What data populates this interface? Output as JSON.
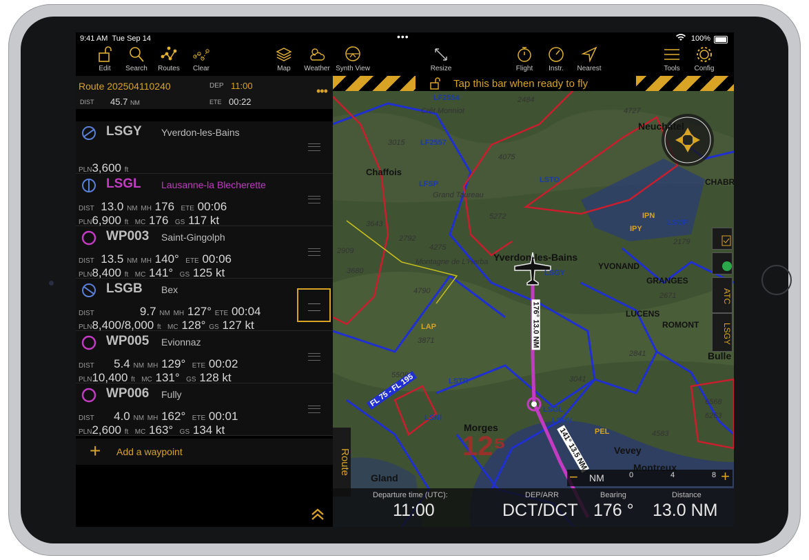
{
  "status_bar": {
    "time": "9:41 AM",
    "date": "Tue Sep 14",
    "dots": "•••",
    "battery": "100%"
  },
  "toolbar": {
    "edit": "Edit",
    "search": "Search",
    "routes": "Routes",
    "clear": "Clear",
    "map": "Map",
    "weather": "Weather",
    "synth_view": "Synth View",
    "resize": "Resize",
    "flight": "Flight",
    "instr": "Instr.",
    "nearest": "Nearest",
    "tools": "Tools",
    "config": "Config"
  },
  "route": {
    "title": "Route 202504110240",
    "dep_label": "DEP",
    "dep_value": "11:00",
    "dist_label": "DIST",
    "dist_value": "45.7",
    "dist_unit": "NM",
    "ete_label": "ETE",
    "ete_value": "00:22",
    "more": "•••"
  },
  "waypoints": [
    {
      "code": "LSGY",
      "name": "Yverdon-les-Bains",
      "pln": "3,600",
      "pln_unit": "ft"
    },
    {
      "code": "LSGL",
      "name": "Lausanne-la Blecherette",
      "dist": "13.0",
      "mh": "176",
      "ete": "00:06",
      "pln": "6,900",
      "mc": "176",
      "gs": "117 kt"
    },
    {
      "code": "WP003",
      "name": "Saint-Gingolph",
      "dist": "13.5",
      "mh": "140°",
      "ete": "00:06",
      "pln": "8,400",
      "mc": "141°",
      "gs": "125 kt"
    },
    {
      "code": "LSGB",
      "name": "Bex",
      "dist": "9.7",
      "mh": "127°",
      "ete": "00:04",
      "pln": "8,400/8,000",
      "mc": "128°",
      "gs": "127 kt"
    },
    {
      "code": "WP005",
      "name": "Evionnaz",
      "dist": "5.4",
      "mh": "129°",
      "ete": "00:02",
      "pln": "10,400",
      "mc": "131°",
      "gs": "128 kt"
    },
    {
      "code": "WP006",
      "name": "Fully",
      "dist": "4.0",
      "mh": "162°",
      "ete": "00:01",
      "pln": "2,600",
      "mc": "163°",
      "gs": "134 kt"
    }
  ],
  "labels": {
    "dist": "DIST",
    "pln": "PLN",
    "nm": "NM",
    "mh": "MH",
    "mc": "MC",
    "ete": "ETE",
    "gs": "GS",
    "ft": "ft"
  },
  "add_waypoint": "Add a waypoint",
  "map": {
    "banner": "Tap this bar when ready to fly",
    "route_tab": "Route",
    "side_tabs": [
      "ATC",
      "LSGY"
    ],
    "scale_unit": "NM",
    "scale_ticks": [
      "0",
      "4",
      "8"
    ],
    "labels": {
      "lf2554": "LF2554",
      "lf2557": "LF2557",
      "chaffois": "Chaffois",
      "lfsp": "LFSP",
      "lsto": "LSTO",
      "yverdon": "Yverdon-les-Bains",
      "lsgy": "LSGY",
      "yvonand": "YVONAND",
      "granges": "GRANGES",
      "lucens": "LUCENS",
      "romont": "ROMONT",
      "bulle": "Bulle",
      "lstr": "LSTR",
      "lsni": "LSNI",
      "morges": "Morges",
      "lsgl": "LSGL",
      "lshv": "LSHV",
      "gland": "Gland",
      "vevey": "Vevey",
      "montreux": "Montreux",
      "neuchatel": "Neuchâtel",
      "chabrey": "CHABRE",
      "lsmp": "LSMP",
      "lap": "LAP",
      "ipn": "IPN",
      "ipy": "IPY",
      "pel": "PEL",
      "fl": "FL 75 - FL 195",
      "leg1": "176° 13.0 NM",
      "leg2": "141° 13.5 NM",
      "big": "12⁵",
      "montagne": "Montagne de L'Herba",
      "cret": "Crêt Monniot",
      "grand": "Grand Taureau",
      "e3015": "3015",
      "e2484": "2484",
      "e4075": "4075",
      "e4727": "4727",
      "e5272": "5272",
      "e3643": "3643",
      "e2792": "2792",
      "e4275": "4275",
      "e2909": "2909",
      "e3680": "3680",
      "e4790": "4790",
      "e3871": "3871",
      "e5508": "5508",
      "e3041": "3041",
      "e2841": "2841",
      "e2671": "2671",
      "e2179": "2179",
      "e4583": "4583",
      "e6568": "6568",
      "e6263": "6263"
    }
  },
  "bottom_bar": {
    "departure_label": "Departure time (UTC):",
    "departure_value": "11:00",
    "deparr_label": "DEP/ARR",
    "deparr_value": "DCT/DCT",
    "bearing_label": "Bearing",
    "bearing_value": "176 °",
    "distance_label": "Distance",
    "distance_value": "13.0 NM"
  },
  "colors": {
    "accent": "#d9a426",
    "magenta": "#c23bc2",
    "airspace_blue": "#1f2fd0",
    "airspace_red": "#c81e2e"
  }
}
